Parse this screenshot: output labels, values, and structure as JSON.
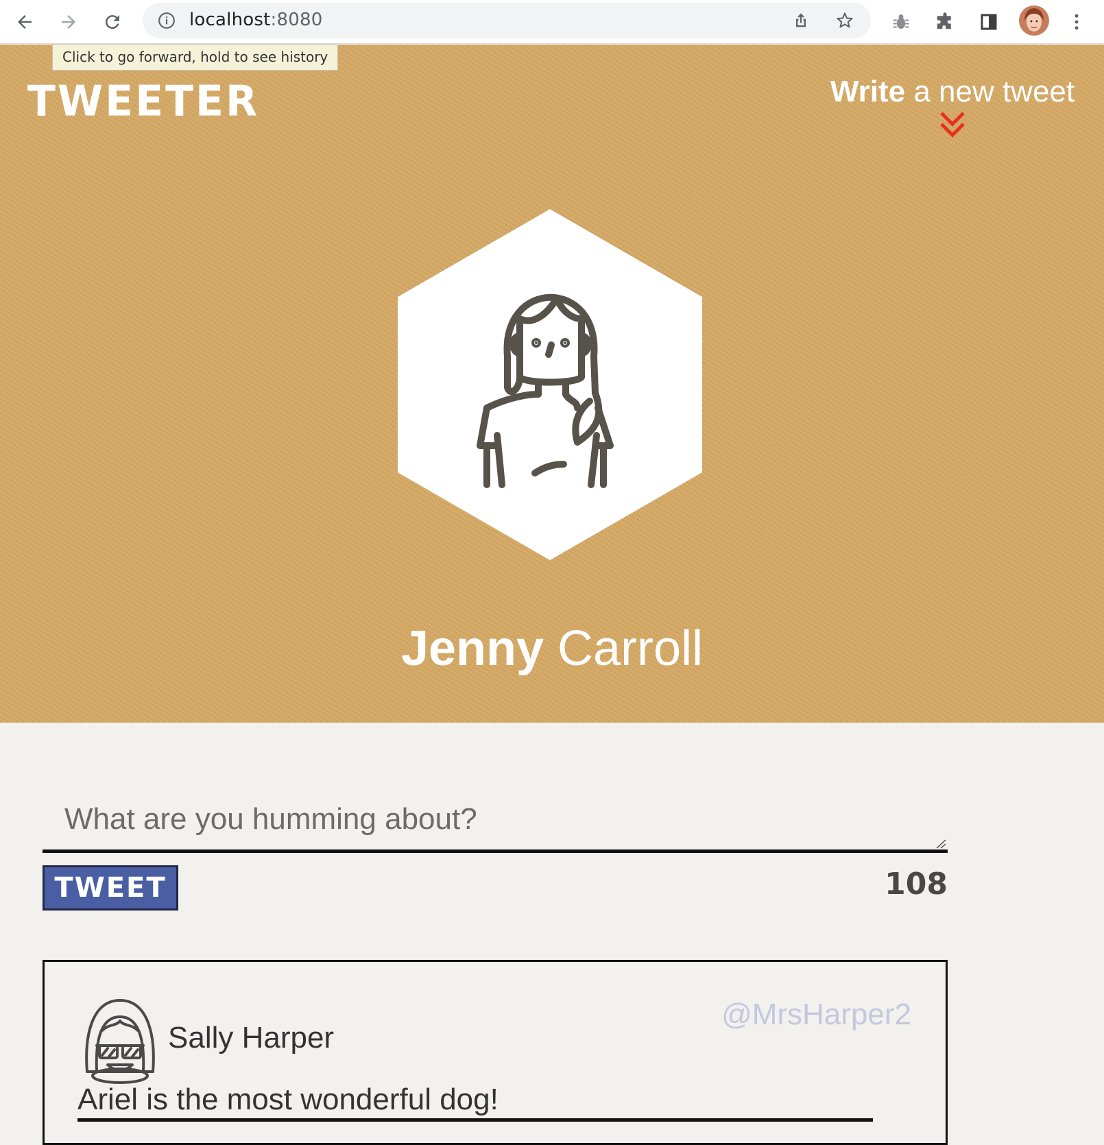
{
  "browser": {
    "url_host": "localhost",
    "url_port": ":8080",
    "tooltip": "Click to go forward, hold to see history"
  },
  "header": {
    "brand": "TWEETER",
    "compose_toggle_strong": "Write",
    "compose_toggle_rest": " a new tweet"
  },
  "profile": {
    "first_name": "Jenny",
    "last_name": " Carroll"
  },
  "compose": {
    "placeholder": "What are you humming about?",
    "button_label": "TWEET",
    "char_counter": "108"
  },
  "tweet": {
    "name": "Sally Harper",
    "handle": "@MrsHarper2",
    "content": "Ariel is the most wonderful dog!"
  },
  "colors": {
    "header_bg": "#d7a963",
    "page_bg": "#f2f1ed",
    "tweet_button": "#4a5fa3",
    "accent_chevron": "#e8301c",
    "handle": "#c3c8de"
  }
}
